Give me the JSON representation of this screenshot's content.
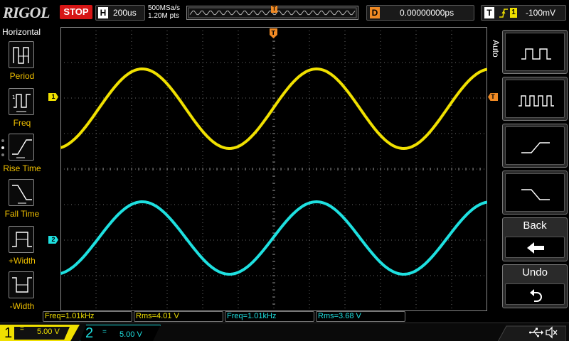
{
  "header": {
    "logo": "RIGOL",
    "run_state": "STOP",
    "horizontal": {
      "letter": "H",
      "timebase": "200us"
    },
    "acquisition": {
      "sample_rate": "500MSa/s",
      "memory_depth": "1.20M pts"
    },
    "trigger_position_marker": "T",
    "delay": {
      "letter": "D",
      "value": "0.00000000ps"
    },
    "trigger": {
      "letter": "T",
      "source": "1",
      "level": "-100mV"
    }
  },
  "left_menu": {
    "title": "Horizontal",
    "items": [
      {
        "label": "Period",
        "icon": "period-icon"
      },
      {
        "label": "Freq",
        "icon": "frequency-icon"
      },
      {
        "label": "Rise Time",
        "icon": "rise-time-icon"
      },
      {
        "label": "Fall Time",
        "icon": "fall-time-icon"
      },
      {
        "label": "+Width",
        "icon": "positive-width-icon"
      },
      {
        "label": "-Width",
        "icon": "negative-width-icon"
      }
    ]
  },
  "right_menu": {
    "title": "Auto",
    "buttons": [
      {
        "label": "",
        "icon": "single-period-wave-icon"
      },
      {
        "label": "",
        "icon": "multi-period-wave-icon"
      },
      {
        "label": "",
        "icon": "rising-edge-icon"
      },
      {
        "label": "",
        "icon": "falling-edge-icon"
      },
      {
        "label": "Back",
        "icon": "back-arrow-icon"
      },
      {
        "label": "Undo",
        "icon": "undo-icon"
      }
    ]
  },
  "channel_markers": {
    "ch1": "1",
    "ch2": "2",
    "trigger_level": "T"
  },
  "measurements": [
    {
      "text": "Freq=1.01kHz",
      "channel": 1
    },
    {
      "text": "Rms=4.01 V",
      "channel": 1
    },
    {
      "text": "Freq=1.01kHz",
      "channel": 2
    },
    {
      "text": "Rms=3.68 V",
      "channel": 2
    }
  ],
  "channels": {
    "ch1": {
      "number": "1",
      "coupling_symbol": "=",
      "scale": "5.00 V",
      "color": "#f0e000"
    },
    "ch2": {
      "number": "2",
      "coupling_symbol": "=",
      "scale": "5.00 V",
      "color": "#1ee0e0"
    }
  },
  "colors": {
    "ch1": "#f0e000",
    "ch2": "#1ee0e0",
    "trigger": "#f08a24",
    "stop": "#d61515"
  }
}
